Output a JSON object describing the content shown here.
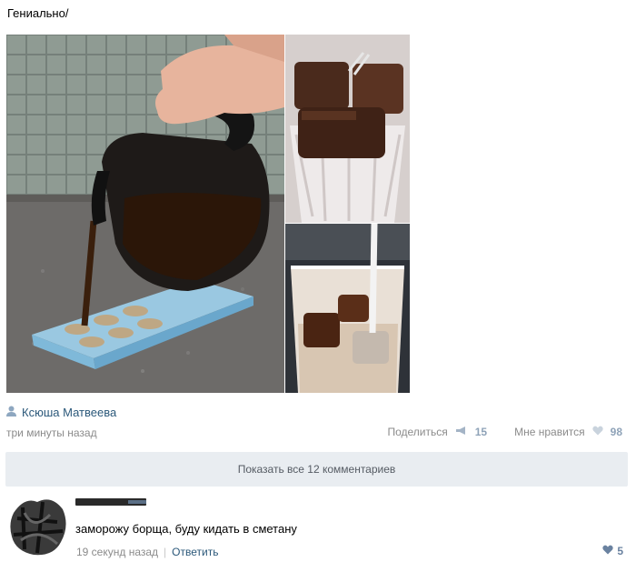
{
  "post": {
    "text": "Гениально/",
    "photos": [
      "coffee-pour-into-ice-tray",
      "coffee-ice-cubes-in-glass",
      "milk-pour-over-coffee-cubes"
    ]
  },
  "author": {
    "name": "Ксюша Матвеева",
    "icon": "user-icon"
  },
  "meta": {
    "time": "три минуты назад",
    "share_label": "Поделиться",
    "share_count": "15",
    "like_label": "Мне нравится",
    "like_count": "98"
  },
  "comments_toggle": {
    "label": "Показать все 12 комментариев"
  },
  "comment": {
    "text": "заморожу борща, буду кидать в сметану",
    "time": "19 секунд назад",
    "separator": "|",
    "reply_label": "Ответить",
    "likes": "5"
  },
  "colors": {
    "link": "#2b587a",
    "muted": "#8b8b8b",
    "panel": "#e9edf1"
  }
}
